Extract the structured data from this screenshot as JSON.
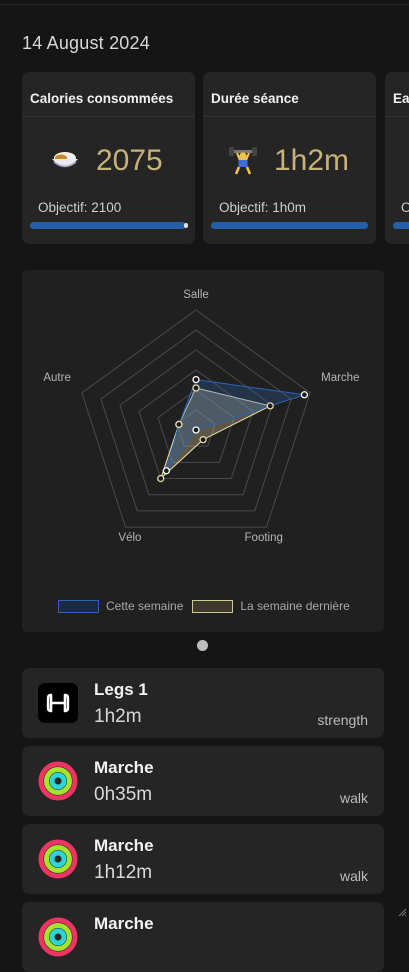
{
  "date": "14 August 2024",
  "cards": [
    {
      "title": "Calories consommées",
      "emoji": "rice-curry-icon",
      "value": "2075",
      "goal": "Objectif: 2100",
      "progress": 0.99
    },
    {
      "title": "Durée séance",
      "emoji": "weightlifter-icon",
      "value": "1h2m",
      "goal": "Objectif: 1h0m",
      "progress": 1.0
    },
    {
      "title": "Ea",
      "goal": "O",
      "progress": 0.5
    }
  ],
  "radar": {
    "axes": [
      "Salle",
      "Marche",
      "Footing",
      "Vélo",
      "Autre"
    ],
    "series": [
      {
        "name": "Cette semaine",
        "values": [
          0.42,
          0.95,
          0.0,
          0.42,
          0.15
        ],
        "color": "#2a63b7"
      },
      {
        "name": "La semaine dernière",
        "values": [
          0.35,
          0.65,
          0.1,
          0.5,
          0.15
        ],
        "color": "#e4dcaa"
      }
    ],
    "levels": 6
  },
  "pager": {
    "current": 1,
    "total": 1
  },
  "activities": [
    {
      "title": "Legs 1",
      "duration": "1h2m",
      "type": "strength",
      "icon": "strength-app-icon"
    },
    {
      "title": "Marche",
      "duration": "0h35m",
      "type": "walk",
      "icon": "activity-rings-icon"
    },
    {
      "title": "Marche",
      "duration": "1h12m",
      "type": "walk",
      "icon": "activity-rings-icon"
    },
    {
      "title": "Marche",
      "icon": "activity-rings-icon"
    }
  ],
  "colors": {
    "accent_value": "#c9b277",
    "progress": "#2260aa",
    "card_bg": "#252525",
    "page_bg": "#151515"
  }
}
